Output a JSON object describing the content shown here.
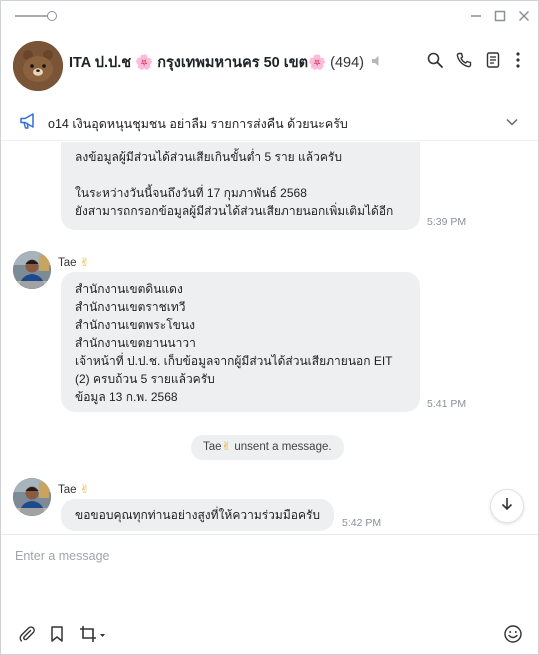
{
  "header": {
    "group_prefix": "ITA ป.ป.ช ",
    "group_name": " กรุงเทพมหานคร 50 เขต",
    "member_count": "(494)",
    "blossom": "🌸"
  },
  "announcement": {
    "text": "o14 เงินอุดหนุนชุมชน อย่าลืม รายการส่งคืน ด้วยนะครับ"
  },
  "messages": {
    "m1": {
      "line1": "ลงข้อมูลผู้มีส่วนได้ส่วนเสียเกินขั้นต่ำ 5 ราย แล้วครับ",
      "line2": "ในระหว่างวันนี้จนถึงวันที่ 17 กุมภาพันธ์ 2568",
      "line3": "ยังสามารถกรอกข้อมูลผู้มีส่วนได้ส่วนเสียภายนอกเพิ่มเติมได้อีก",
      "time": "5:39 PM"
    },
    "m2": {
      "sender": "Tae",
      "hand": "✌",
      "lines": [
        "สำนักงานเขตดินแดง",
        "สำนักงานเขตราชเทวี",
        "สำนักงานเขตพระโขนง",
        "สำนักงานเขตยานนาวา",
        "เจ้าหน้าที่ ป.ป.ช. เก็บข้อมูลจากผู้มีส่วนได้ส่วนเสียภายนอก EIT",
        "(2) ครบถ้วน 5 รายแล้วครับ",
        "ข้อมูล 13 ก.พ. 2568"
      ],
      "time": "5:41 PM"
    },
    "system": {
      "actor": "Tae",
      "hand": "✌",
      "text": " unsent a message."
    },
    "m3": {
      "sender": "Tae",
      "hand": "✌",
      "text": "ขอขอบคุณทุกท่านอย่างสูงที่ให้ความร่วมมือครับ",
      "time": "5:42 PM"
    }
  },
  "composer": {
    "placeholder": "Enter a message",
    "value": ""
  },
  "colors": {
    "bubble": "#eeeff1",
    "accent_blue": "#2f6fd6",
    "blossom_pink": "#e7508f"
  }
}
